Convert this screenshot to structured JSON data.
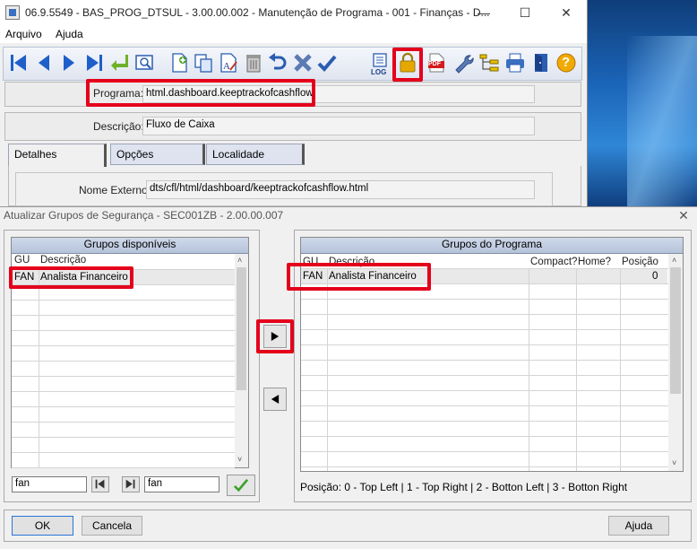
{
  "window": {
    "title": "06.9.5549 - BAS_PROG_DTSUL - 3.00.00.002 - Manutenção de Programa - 001 - Finanças - D...",
    "minimize": "—",
    "maximize": "☐",
    "close": "✕"
  },
  "menu": {
    "items": [
      "Arquivo",
      "Ajuda"
    ]
  },
  "form": {
    "programa_label": "Programa:",
    "programa_value": "html.dashboard.keeptrackofcashflow",
    "descricao_label": "Descrição:",
    "descricao_value": "Fluxo de Caixa",
    "tabs": [
      "Detalhes",
      "Opções",
      "Localidade"
    ],
    "nome_externo_label": "Nome Externo:",
    "nome_externo_value": "dts/cfl/html/dashboard/keeptrackofcashflow.html"
  },
  "toolbar": {
    "log_label": "LOG",
    "pdf_label": "PDF",
    "help_label": "?",
    "icons": [
      "first-icon",
      "prev-icon",
      "next-icon",
      "last-icon",
      "goto-icon",
      "search-icon",
      "new-icon",
      "copy-icon",
      "edit-icon",
      "delete-icon",
      "undo-icon",
      "cancel-icon",
      "confirm-icon",
      "log-icon",
      "security-lock-icon",
      "pdf-icon",
      "wrench-icon",
      "tree-icon",
      "print-icon",
      "exit-icon",
      "help-icon"
    ]
  },
  "dialog": {
    "title": "Atualizar Grupos de Segurança - SEC001ZB - 2.00.00.007",
    "close": "✕",
    "available": {
      "header": "Grupos disponíveis",
      "columns": [
        "GU",
        "Descrição"
      ],
      "rows": [
        {
          "gu": "FAN",
          "desc": "Analista Financeiro"
        }
      ]
    },
    "program": {
      "header": "Grupos do Programa",
      "columns": [
        "GU",
        "Descrição",
        "Compact?",
        "Home?",
        "Posição"
      ],
      "rows": [
        {
          "gu": "FAN",
          "desc": "Analista Financeiro",
          "compact": "",
          "home": "",
          "pos": "0"
        }
      ]
    },
    "filter_from": "fan",
    "filter_to": "fan",
    "position_legend": "Posição: 0 - Top Left | 1 - Top Right | 2 - Botton Left | 3 - Botton Right",
    "ok_label": "OK",
    "cancel_label": "Cancela",
    "help_label": "Ajuda"
  },
  "colors": {
    "highlight_red": "#e4001b",
    "header_blue": "#b5c3da",
    "lock_gold": "#e6a800"
  }
}
